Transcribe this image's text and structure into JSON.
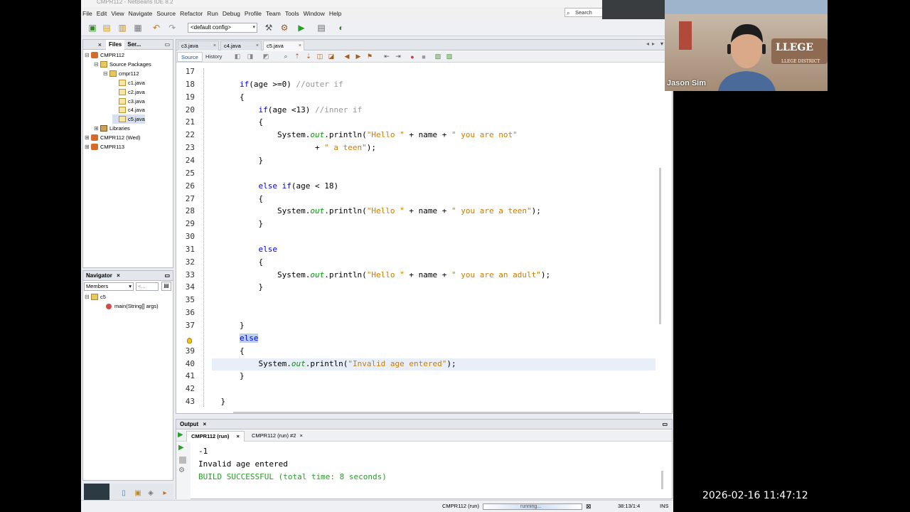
{
  "window": {
    "title": "CMPR112 - NetBeans IDE 8.2"
  },
  "menu": [
    "File",
    "Edit",
    "View",
    "Navigate",
    "Source",
    "Refactor",
    "Run",
    "Debug",
    "Profile",
    "Team",
    "Tools",
    "Window",
    "Help"
  ],
  "search": {
    "placeholder": "Search (Ctrl+I)",
    "shown": "Search"
  },
  "toolbar": {
    "config": "<default config>"
  },
  "projects": {
    "tabs": [
      "Files",
      "Ser..."
    ],
    "tree": [
      {
        "label": "CMPR112",
        "level": 0,
        "icon": "project-icon",
        "toggle": "⊟"
      },
      {
        "label": "Source Packages",
        "level": 1,
        "icon": "source-packages-icon",
        "toggle": "⊟"
      },
      {
        "label": "cmpr112",
        "level": 2,
        "icon": "package-icon",
        "toggle": "⊟"
      },
      {
        "label": "c1.java",
        "level": 3,
        "icon": "java-file-icon",
        "toggle": ""
      },
      {
        "label": "c2.java",
        "level": 3,
        "icon": "java-file-icon",
        "toggle": ""
      },
      {
        "label": "c3.java",
        "level": 3,
        "icon": "java-file-icon",
        "toggle": ""
      },
      {
        "label": "c4.java",
        "level": 3,
        "icon": "java-file-icon",
        "toggle": ""
      },
      {
        "label": "c5.java",
        "level": 3,
        "icon": "java-file-icon",
        "toggle": "",
        "selected": true
      },
      {
        "label": "Libraries",
        "level": 1,
        "icon": "libraries-icon",
        "toggle": "⊞"
      },
      {
        "label": "CMPR112 (Wed)",
        "level": 0,
        "icon": "project-icon",
        "toggle": "⊞"
      },
      {
        "label": "CMPR113",
        "level": 0,
        "icon": "project-icon",
        "toggle": "⊞"
      }
    ]
  },
  "navigator": {
    "title": "Navigator",
    "filter": "Members",
    "filter2": "<...",
    "class_name": "c5",
    "method": "main(String[] args)"
  },
  "editor": {
    "tabs": [
      "c3.java",
      "c4.java",
      "c5.java"
    ],
    "view_tabs": [
      "Source",
      "History"
    ],
    "line_numbers": [
      "17",
      "18",
      "19",
      "20",
      "21",
      "22",
      "23",
      "24",
      "25",
      "26",
      "27",
      "28",
      "29",
      "30",
      "31",
      "32",
      "33",
      "34",
      "35",
      "36",
      "37",
      "",
      "39",
      "40",
      "41",
      "42",
      "43"
    ],
    "code": [
      "",
      "        if(age >=0) //outer if",
      "        {",
      "            if(age <13) //inner if",
      "            {",
      "                System.out.println(\"Hello \" + name + \" you are not\"",
      "                        + \" a teen\");",
      "            }",
      "",
      "            else if(age < 18)",
      "            {",
      "                System.out.println(\"Hello \" + name + \" you are a teen\");",
      "            }",
      "",
      "            else",
      "            {",
      "                System.out.println(\"Hello \" + name + \" you are an adult\");",
      "            }",
      "",
      "",
      "        }",
      "        else",
      "        {",
      "            System.out.println(\"Invalid age entered\");",
      "        }",
      "",
      "    }"
    ]
  },
  "output": {
    "title": "Output",
    "tabs": [
      "CMPR112 (run)",
      "CMPR112 (run) #2"
    ],
    "lines": [
      "-1",
      "Invalid age entered",
      "BUILD SUCCESSFUL (total time: 8 seconds)"
    ]
  },
  "status": {
    "run": "CMPR112 (run)",
    "progress": "running...",
    "position": "38:13/1:4",
    "mode": "INS"
  },
  "webcam": {
    "name": "Jason Sim",
    "sign": "LLEGE",
    "sign_sub": "LLEGE DISTRICT"
  },
  "timestamp": "2026-02-16 11:47:12"
}
